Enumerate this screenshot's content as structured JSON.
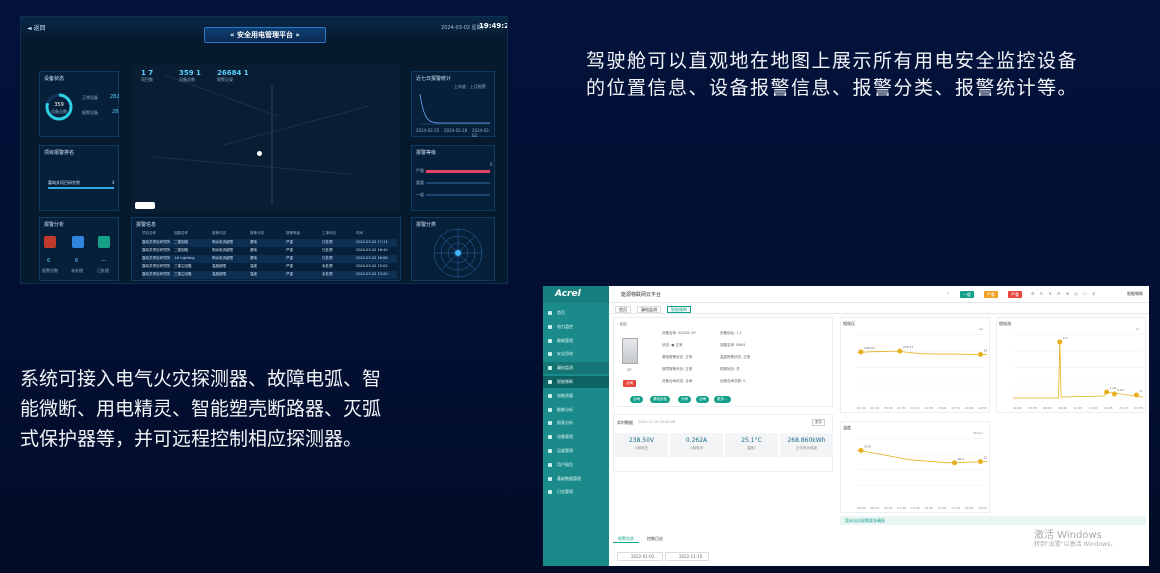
{
  "dashboard": {
    "back": "返回",
    "title": "« 安全用电管理平台 »",
    "date": "2024-03-02   星期六",
    "time": "19:49:29",
    "device_status": {
      "title": "设备状态",
      "total": "359",
      "total_label": "设备总数",
      "normal_label": "正常设备",
      "normal": "282",
      "alarm_label": "报警设备",
      "alarm": "28"
    },
    "map_stats": [
      {
        "n": "1 7",
        "l": "项目数"
      },
      {
        "n": "359 1",
        "l": "设备总数"
      },
      {
        "n": "26684 1",
        "l": "报警记录"
      }
    ],
    "project_alarm": {
      "title": "项目报警排名",
      "row": "嘉峪关项目研究院",
      "value": "4"
    },
    "alarm_analysis": {
      "title": "报警分析",
      "items": [
        {
          "n": "6",
          "l": "报警总数"
        },
        {
          "n": "6",
          "l": "未处理"
        },
        {
          "n": "—",
          "l": "已处理"
        }
      ]
    },
    "alarm_info": {
      "title": "报警信息",
      "headers": [
        "项目名称",
        "回路名称",
        "报警内容",
        "报警分类",
        "报警等级",
        "工单状态",
        "时间"
      ],
      "rows": [
        [
          "嘉峪关项目研究院",
          "二楼回路",
          "剩余电流超限",
          "漏电",
          "严重",
          "已处理",
          "2024-03-02 17:11"
        ],
        [
          "嘉峪关项目研究院",
          "二楼回路",
          "剩余电流超限",
          "漏电",
          "严重",
          "已处理",
          "2024-03-02 16:40"
        ],
        [
          "嘉峪关项目研究院",
          "1# Lighting",
          "剩余电流超限",
          "漏电",
          "严重",
          "已处理",
          "2024-03-02 16:08"
        ],
        [
          "嘉峪关项目研究院",
          "三楼主回路",
          "温度超限",
          "温度",
          "严重",
          "未处理",
          "2024-03-02 15:02"
        ],
        [
          "嘉峪关项目研究院",
          "三楼主回路",
          "温度超限",
          "温度",
          "严重",
          "未处理",
          "2024-03-02 13:20"
        ]
      ]
    },
    "trend": {
      "title": "近七日报警统计",
      "legend1": "上年度",
      "legend2": "上月报警",
      "ticks": [
        "2024-02-25",
        "2024-02-28",
        "2024-03-02"
      ]
    },
    "level": {
      "title": "报警等级",
      "items": [
        {
          "l": "严重",
          "v": "6"
        },
        {
          "l": "重要",
          "v": "0"
        },
        {
          "l": "一般",
          "v": "0"
        }
      ]
    },
    "category": {
      "title": "报警分类"
    }
  },
  "texts": {
    "top_right": "驾驶舱可以直观地在地图上展示所有用电安全监控设备的位置信息、设备报警信息、报警分类、报警统计等。",
    "bottom_left": "系统可接入电气火灾探测器、故障电弧、智能微断、用电精灵、智能塑壳断路器、灭弧式保护器等，并可远程控制相应探测器。"
  },
  "app": {
    "logo": "Acrel",
    "title": "能源物联网云平台",
    "header_chips": [
      "一般",
      "严重",
      "严重"
    ],
    "right_label": "智能物联",
    "nav": [
      "首页",
      "电力监控",
      "能耗管理",
      "安全用电",
      "漏电监测",
      "智能微断",
      "电能质量",
      "能耗分析",
      "报表分析",
      "设备管理",
      "运维管理",
      "用户报告",
      "基础数据管理",
      "日志管理"
    ],
    "tabs": [
      "首页",
      "漏电监测",
      "智能微断"
    ],
    "back": "返回",
    "device_info": {
      "device_label": "2P",
      "tag": "合闸",
      "fields": [
        [
          "设备名称:  ASCB1-2P",
          "设备地址:  1,1"
        ],
        [
          "状态:  ● 正常",
          "回路名称:  B604"
        ],
        [
          "漏电报警状态:  正常",
          "温度报警状态:  正常"
        ],
        [
          "故障报警状态:  正常",
          "短路状态:  关"
        ],
        [
          "设备合闸状态:  合闸",
          "远程合闸次数:  0"
        ]
      ],
      "buttons": [
        "合闸",
        "漏电自检",
        "分闸",
        "合闸",
        "更多…"
      ]
    },
    "realtime": {
      "title": "实时数据",
      "date": "2022-11-15 19:40:06",
      "more": "更多",
      "items": [
        {
          "v": "238.50V",
          "u": "A相电压"
        },
        {
          "v": "0.262A",
          "u": "A相电流"
        },
        {
          "v": "25.1°C",
          "u": "温度1"
        },
        {
          "v": "268.860kWh",
          "u": "正向有功电能"
        }
      ]
    },
    "charts": [
      {
        "title": "相电压",
        "legend": "Ua",
        "ymax": 300,
        "x": [
          "00:00",
          "02:20",
          "05:00",
          "07:30",
          "10:00",
          "12:30",
          "15:00",
          "17:30",
          "20:00",
          "22:55"
        ],
        "peaks": [
          "248.00",
          "245.17",
          "238.50"
        ]
      },
      {
        "title": "相电流",
        "legend": "Ia",
        "ymax": 8,
        "x": [
          "00:00",
          "03:05",
          "06:00",
          "09:40",
          "12:15",
          "14:20",
          "16:05",
          "21:40",
          "23:55"
        ],
        "peaks": [
          "9.3",
          "1.04",
          "0.87",
          "0.41"
        ]
      },
      {
        "title": "温度",
        "legend": "Temp1",
        "ymax": 30,
        "x": [
          "00:00",
          "02:25",
          "05:00",
          "07:30",
          "10:00",
          "12:30",
          "15:00",
          "17:30",
          "20:00",
          "22:55"
        ],
        "peaks": [
          "29.8",
          "26.1",
          "25.09"
        ]
      }
    ],
    "notice": "暂未出出现需要多确报",
    "bottom_tabs": [
      "报警信息",
      "控制日志"
    ],
    "date_from": "2022-01-01",
    "date_to": "2022-11-15",
    "watermark1": "激活 Windows",
    "watermark2": "转到\"设置\"以激活 Windows。"
  }
}
